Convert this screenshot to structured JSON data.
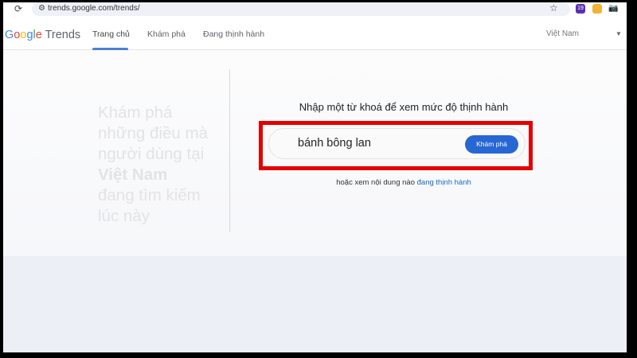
{
  "browser": {
    "url": "trends.google.com/trends/",
    "extension_badge": "19"
  },
  "header": {
    "logo": {
      "g1": "G",
      "g2": "o",
      "g3": "o",
      "g4": "g",
      "g5": "l",
      "g6": "e",
      "suffix": " Trends"
    },
    "nav": [
      {
        "label": "Trang chủ"
      },
      {
        "label": "Khám phá"
      },
      {
        "label": "Đang thịnh hành"
      }
    ],
    "region": "Việt Nam"
  },
  "hero": {
    "line1": "Khám phá",
    "line2": "những điều mà",
    "line3": "người dùng tại",
    "country": "Việt Nam",
    "line5": "đang tìm kiếm",
    "line6": "lúc này"
  },
  "search": {
    "prompt": "Nhập một từ khoá để xem mức độ thịnh hành",
    "value": "bánh bông lan",
    "button": "Khám phá",
    "alt_text": "hoặc xem nội dung nào ",
    "alt_link": "đang thịnh hành"
  },
  "colors": {
    "accent": "#2767d3",
    "highlight": "#e30000"
  }
}
